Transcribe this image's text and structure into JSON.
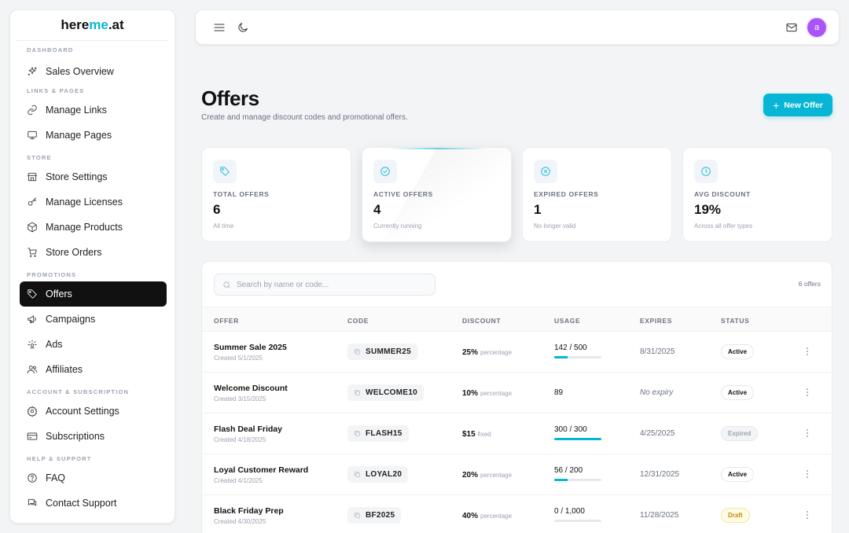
{
  "brand": {
    "part1": "here",
    "part2": "me",
    "part3": ".at",
    "accent": "#06b6d4"
  },
  "sidebar": {
    "sections": [
      {
        "label": "DASHBOARD",
        "items": [
          {
            "label": "Sales Overview",
            "icon": "sparkles-icon"
          }
        ]
      },
      {
        "label": "LINKS & PAGES",
        "items": [
          {
            "label": "Manage Links",
            "icon": "link-icon"
          },
          {
            "label": "Manage Pages",
            "icon": "monitor-icon"
          }
        ]
      },
      {
        "label": "STORE",
        "items": [
          {
            "label": "Store Settings",
            "icon": "store-icon"
          },
          {
            "label": "Manage Licenses",
            "icon": "key-icon"
          },
          {
            "label": "Manage Products",
            "icon": "box-icon"
          },
          {
            "label": "Store Orders",
            "icon": "cart-icon"
          }
        ]
      },
      {
        "label": "PROMOTIONS",
        "items": [
          {
            "label": "Offers",
            "icon": "tag-icon",
            "active": true
          },
          {
            "label": "Campaigns",
            "icon": "megaphone-icon"
          },
          {
            "label": "Ads",
            "icon": "ads-icon"
          },
          {
            "label": "Affiliates",
            "icon": "users-icon"
          }
        ]
      },
      {
        "label": "ACCOUNT & SUBSCRIPTION",
        "items": [
          {
            "label": "Account Settings",
            "icon": "gear-icon"
          },
          {
            "label": "Subscriptions",
            "icon": "card-icon"
          }
        ]
      },
      {
        "label": "HELP & SUPPORT",
        "items": [
          {
            "label": "FAQ",
            "icon": "help-icon"
          },
          {
            "label": "Contact Support",
            "icon": "chat-icon"
          }
        ]
      }
    ]
  },
  "topbar": {
    "avatar_initial": "a",
    "avatar_color": "#a855f7"
  },
  "header": {
    "title": "Offers",
    "subtitle": "Create and manage discount codes and promotional offers.",
    "new_button": "New Offer"
  },
  "stats": [
    {
      "label": "TOTAL OFFERS",
      "value": "6",
      "note": "All time",
      "icon": "tag-icon"
    },
    {
      "label": "ACTIVE OFFERS",
      "value": "4",
      "note": "Currently running",
      "icon": "check-circle-icon"
    },
    {
      "label": "EXPIRED OFFERS",
      "value": "1",
      "note": "No longer valid",
      "icon": "x-circle-icon"
    },
    {
      "label": "AVG DISCOUNT",
      "value": "19%",
      "note": "Across all offer types",
      "icon": "clock-icon"
    }
  ],
  "table": {
    "search_placeholder": "Search by name or code...",
    "count": "6 offers",
    "columns": [
      "OFFER",
      "CODE",
      "DISCOUNT",
      "USAGE",
      "EXPIRES",
      "STATUS"
    ],
    "rows": [
      {
        "name": "Summer Sale 2025",
        "created": "Created 5/1/2025",
        "code": "SUMMER25",
        "discount": "25%",
        "discount_type": "percentage",
        "usage": "142 / 500",
        "usage_fraction": 0.284,
        "expires": "8/31/2025",
        "status": "Active"
      },
      {
        "name": "Welcome Discount",
        "created": "Created 3/15/2025",
        "code": "WELCOME10",
        "discount": "10%",
        "discount_type": "percentage",
        "usage": "89",
        "expires": "No expiry",
        "status": "Active"
      },
      {
        "name": "Flash Deal Friday",
        "created": "Created 4/18/2025",
        "code": "FLASH15",
        "discount": "$15",
        "discount_type": "fixed",
        "usage": "300 / 300",
        "usage_fraction": 1.0,
        "expires": "4/25/2025",
        "status": "Expired"
      },
      {
        "name": "Loyal Customer Reward",
        "created": "Created 4/1/2025",
        "code": "LOYAL20",
        "discount": "20%",
        "discount_type": "percentage",
        "usage": "56 / 200",
        "usage_fraction": 0.28,
        "expires": "12/31/2025",
        "status": "Active"
      },
      {
        "name": "Black Friday Prep",
        "created": "Created 4/30/2025",
        "code": "BF2025",
        "discount": "40%",
        "discount_type": "percentage",
        "usage": "0 / 1,000",
        "usage_fraction": 0.0,
        "expires": "11/28/2025",
        "status": "Draft"
      }
    ]
  }
}
